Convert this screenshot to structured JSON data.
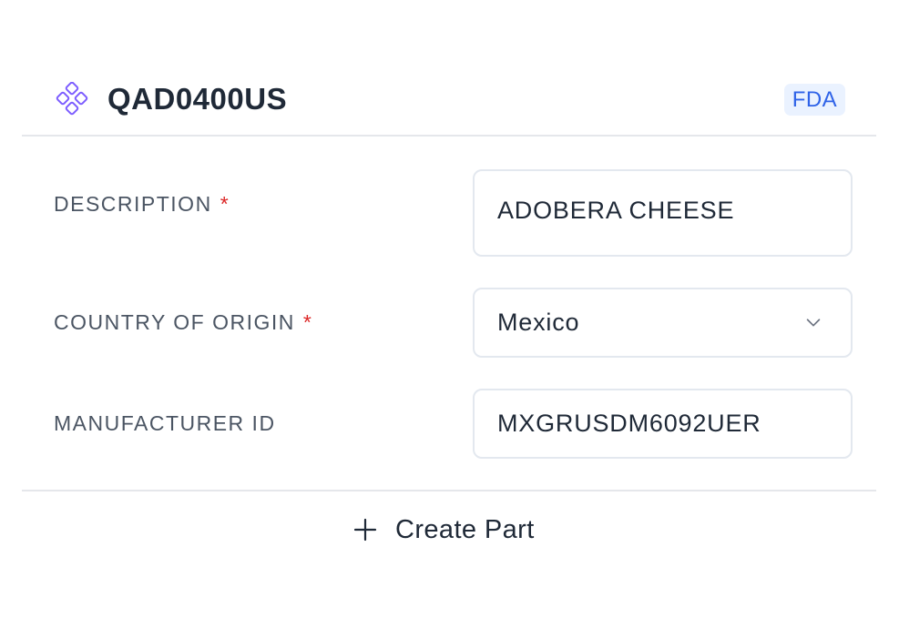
{
  "part": {
    "code": "QAD0400US",
    "badge": "FDA"
  },
  "fields": {
    "description": {
      "label": "DESCRIPTION",
      "required_mark": "*",
      "value": "ADOBERA CHEESE"
    },
    "country_of_origin": {
      "label": "COUNTRY OF ORIGIN",
      "required_mark": "*",
      "value": "Mexico"
    },
    "manufacturer_id": {
      "label": "MANUFACTURER ID",
      "value": "MXGRUSDM6092UER"
    }
  },
  "actions": {
    "create_part_label": "Create Part"
  },
  "icons": {
    "part": "diamond-cluster-icon",
    "select": "chevron-down-icon",
    "add": "plus-icon"
  },
  "colors": {
    "accent": "#7c5cff",
    "badge_bg": "#eaf2ff",
    "badge_text": "#2f63e8",
    "required": "#dc2626"
  }
}
